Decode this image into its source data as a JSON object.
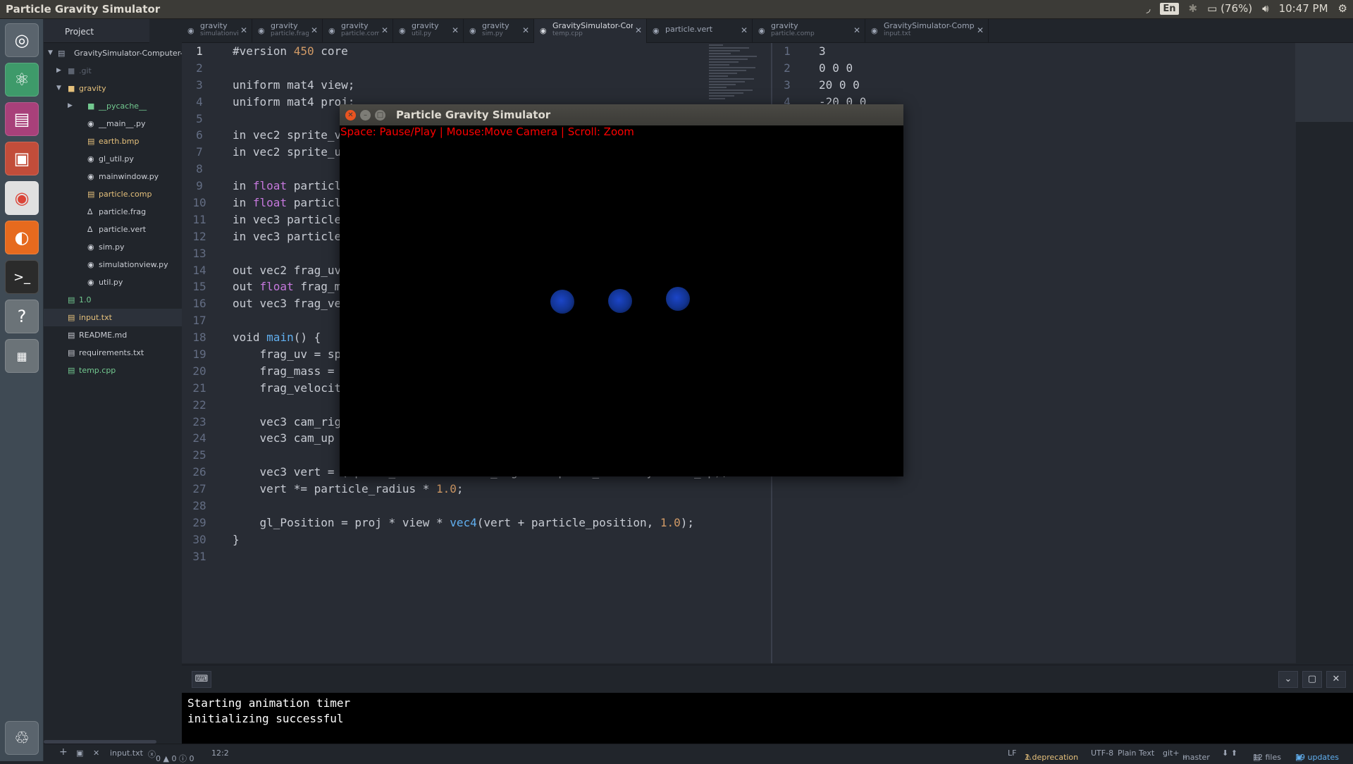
{
  "topbar": {
    "title": "Particle Gravity Simulator",
    "language": "En",
    "battery": "(76%)",
    "time": "10:47 PM"
  },
  "launcher": {
    "items": [
      "system-settings-icon",
      "atom-icon",
      "app-icon",
      "files-icon",
      "chrome-icon",
      "firefox-icon",
      "terminal-icon",
      "help-icon",
      "workspaces-icon",
      "trash-icon"
    ]
  },
  "project": {
    "tab_label": "Project",
    "root": "GravitySimulator-Computer-Gr",
    "items": [
      {
        "name": ".git",
        "kind": "folder-collapsed",
        "level": 1
      },
      {
        "name": "gravity",
        "kind": "folder-open",
        "level": 1
      },
      {
        "name": "__pycache__",
        "kind": "folder-collapsed",
        "level": 2
      },
      {
        "name": "__main__.py",
        "kind": "file",
        "level": 2
      },
      {
        "name": "earth.bmp",
        "kind": "file",
        "level": 2
      },
      {
        "name": "gl_util.py",
        "kind": "file",
        "level": 2
      },
      {
        "name": "mainwindow.py",
        "kind": "file",
        "level": 2
      },
      {
        "name": "particle.comp",
        "kind": "file",
        "level": 2
      },
      {
        "name": "particle.frag",
        "kind": "file",
        "level": 2
      },
      {
        "name": "particle.vert",
        "kind": "file",
        "level": 2
      },
      {
        "name": "sim.py",
        "kind": "file",
        "level": 2
      },
      {
        "name": "simulationview.py",
        "kind": "file",
        "level": 2
      },
      {
        "name": "util.py",
        "kind": "file",
        "level": 2
      },
      {
        "name": "1.0",
        "kind": "file",
        "level": 1
      },
      {
        "name": "input.txt",
        "kind": "file",
        "level": 1
      },
      {
        "name": "README.md",
        "kind": "file",
        "level": 1
      },
      {
        "name": "requirements.txt",
        "kind": "file",
        "level": 1
      },
      {
        "name": "temp.cpp",
        "kind": "file",
        "level": 1
      }
    ]
  },
  "tabs": [
    {
      "l1": "gravity",
      "l2": "simulationvie..."
    },
    {
      "l1": "gravity",
      "l2": "particle.frag"
    },
    {
      "l1": "gravity",
      "l2": "particle.comp"
    },
    {
      "l1": "gravity",
      "l2": "util.py"
    },
    {
      "l1": "gravity",
      "l2": "sim.py"
    },
    {
      "l1": "GravitySimulator-Comput...",
      "l2": "temp.cpp"
    },
    {
      "l1": "particle.vert",
      "l2": ""
    },
    {
      "l1": "gravity",
      "l2": "particle.comp"
    },
    {
      "l1": "GravitySimulator-Compute...",
      "l2": "input.txt"
    }
  ],
  "editor_left": {
    "line_numbers": [
      "1",
      "2",
      "3",
      "4",
      "5",
      "6",
      "7",
      "8",
      "9",
      "10",
      "11",
      "12",
      "13",
      "14",
      "15",
      "16",
      "17",
      "18",
      "19",
      "20",
      "21",
      "22",
      "23",
      "24",
      "25",
      "26",
      "27",
      "28",
      "29",
      "30",
      "31"
    ],
    "lines": [
      "#version 450 core",
      "",
      "uniform mat4 view;",
      "uniform mat4 proj;",
      "",
      "in vec2 sprite_v",
      "in vec2 sprite_u",
      "",
      "in float particl",
      "in float particl",
      "in vec3 particle",
      "in vec3 particle",
      "",
      "out vec2 frag_uv",
      "out float frag_m",
      "out vec3 frag_ve",
      "",
      "void main() {",
      "    frag_uv = sp",
      "    frag_mass = ",
      "    frag_velocit",
      "",
      "    vec3 cam_rig",
      "    vec3 cam_up ",
      "",
      "    vec3 vert = (sprite_vertex.x * cam_right + sprite_vertex.y * cam_up);",
      "    vert *= particle_radius * 1.0;",
      "",
      "    gl_Position = proj * view * vec4(vert + particle_position, 1.0);",
      "}",
      ""
    ]
  },
  "editor_right": {
    "line_numbers": [
      "1",
      "2",
      "3",
      "4"
    ],
    "lines": [
      "3",
      "0 0 0",
      "20 0 0",
      "-20 0 0"
    ]
  },
  "simulator": {
    "title": "Particle Gravity Simulator",
    "help": "Space: Pause/Play | Mouse:Move Camera | Scroll: Zoom",
    "particle_count": 3
  },
  "terminal": {
    "lines": [
      "Starting animation timer",
      "initializing successful"
    ]
  },
  "status": {
    "file": "input.txt",
    "counts": "0 ▲ 0 ⓘ 0",
    "cursor": "12:2",
    "eol": "LF",
    "deprecation": "1 deprecation",
    "encoding": "UTF-8",
    "grammar": "Plain Text",
    "git": "git+",
    "branch": "master",
    "files": "12 files",
    "updates": "19 updates"
  },
  "colors": {
    "accent_orange": "#e5c07b",
    "modified_orange": "#d19a66",
    "new_green": "#73c990",
    "sim_help_red": "#ff0000",
    "particle_blue": "#1b45c8"
  }
}
